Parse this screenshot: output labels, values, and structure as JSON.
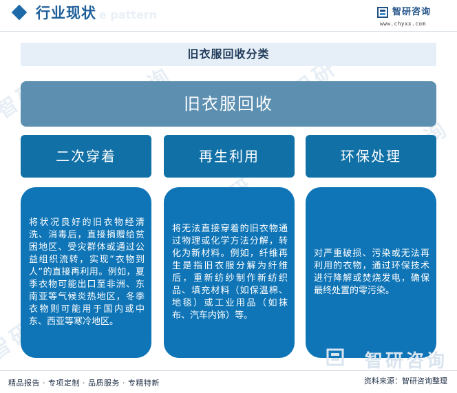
{
  "header": {
    "title": "行业现状",
    "ghost_text": "e pattern"
  },
  "brand": {
    "name": "智研咨询",
    "url": "www.chyxx.com"
  },
  "section_title": "旧衣服回收分类",
  "root": {
    "label": "旧衣服回收"
  },
  "categories": [
    {
      "label": "二次穿着",
      "description": "将状况良好的旧衣物经清洗、消毒后，直接捐赠给贫困地区、受灾群体或通过公益组织流转，实现“衣物到人”的直接再利用。例如，夏季衣物可能出口至非洲、东南亚等气候炎热地区，冬季衣物则可能用于国内或中东、西亚等寒冷地区。"
    },
    {
      "label": "再生利用",
      "description": "将无法直接穿着的旧衣物通过物理或化学方法分解，转化为新材料。例如，纤维再生是指旧衣服分解为纤维后，重新纺纱制作新纺织品、填充材料（如保温棉、地毯）或工业用品（如抹布、汽车内饰）等。"
    },
    {
      "label": "环保处理",
      "description": "对严重破损、污染或无法再利用的衣物，通过环保技术进行降解或焚烧发电，确保最终处置的零污染。"
    }
  ],
  "footer": {
    "tagline": "精品报告 · 专项定制 · 品质服务 · 专精特新",
    "source": "资料来源：智研咨询整理",
    "watermark": "智研咨询"
  },
  "colors": {
    "accent": "#1e6aa8",
    "root_fill": "#5c8fb0",
    "category_fill": "#1170a6",
    "description_fill": "#0f75b7",
    "title_band": "#e6eff7"
  }
}
